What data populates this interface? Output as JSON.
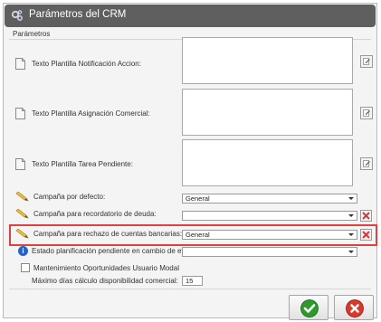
{
  "window": {
    "title": "Parámetros del CRM"
  },
  "group": {
    "label": "Parámetros"
  },
  "templates": [
    {
      "label": "Texto Plantilla Notificación Accion:"
    },
    {
      "label": "Texto Plantilla Asignación Comercial:"
    },
    {
      "label": "Texto Plantilla Tarea Pendiente:"
    }
  ],
  "fields": {
    "campana_defecto": {
      "label": "Campaña por defecto:",
      "value": "General"
    },
    "campana_recordatorio": {
      "label": "Campaña para recordatorio de deuda:",
      "value": ""
    },
    "campana_rechazo": {
      "label": "Campaña para rechazo de cuentas bancarias:",
      "value": "General"
    },
    "estado_planificacion": {
      "label": "Estado planificación pendiente en cambio de etapa:",
      "value": ""
    },
    "mantenimiento": {
      "label": "Mantenimiento Oportunidades Usuario Modal",
      "checked": false
    },
    "maximo_dias": {
      "label": "Máximo días cálculo disponibilidad comercial:",
      "value": "15"
    }
  },
  "colors": {
    "titlebar": "#5f5f5f",
    "highlight": "#e04040",
    "accept": "#2e9a2e",
    "cancel": "#d8392b"
  }
}
